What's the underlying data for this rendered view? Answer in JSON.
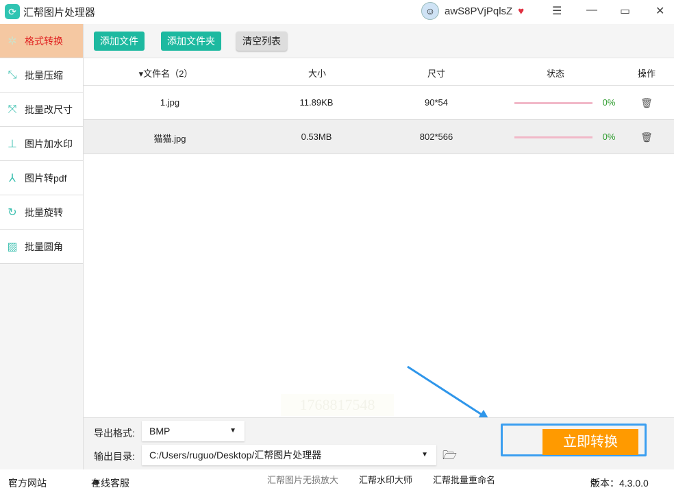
{
  "app": {
    "title": "汇帮图片处理器",
    "username": "awS8PVjPqlsZ"
  },
  "sidebar": {
    "items": [
      {
        "label": "格式转换",
        "icon": "convert-icon"
      },
      {
        "label": "批量压缩",
        "icon": "compress-icon"
      },
      {
        "label": "批量改尺寸",
        "icon": "resize-icon"
      },
      {
        "label": "图片加水印",
        "icon": "watermark-icon"
      },
      {
        "label": "图片转pdf",
        "icon": "pdf-icon"
      },
      {
        "label": "批量旋转",
        "icon": "rotate-icon"
      },
      {
        "label": "批量圆角",
        "icon": "image-icon"
      }
    ]
  },
  "toolbar": {
    "add_file": "添加文件",
    "add_folder": "添加文件夹",
    "clear": "清空列表"
  },
  "table": {
    "headers": {
      "name": "文件名（2）",
      "size": "大小",
      "dim": "尺寸",
      "status": "状态",
      "action": "操作"
    },
    "rows": [
      {
        "name": "1.jpg",
        "size": "11.89KB",
        "dim": "90*54",
        "progress": "0%"
      },
      {
        "name": "猫猫.jpg",
        "size": "0.53MB",
        "dim": "802*566",
        "progress": "0%"
      }
    ]
  },
  "watermark": "1768817548",
  "bottom": {
    "format_label": "导出格式:",
    "format_value": "BMP",
    "dir_label": "输出目录:",
    "dir_value": "C:/Users/ruguo/Desktop/汇帮图片处理器",
    "convert": "立即转换"
  },
  "footer": {
    "website": "官方网站",
    "support": "在线客服",
    "link1": "汇帮图片无损放大",
    "link2": "汇帮水印大师",
    "link3": "汇帮批量重命名",
    "version": "版本：4.3.0.0"
  }
}
